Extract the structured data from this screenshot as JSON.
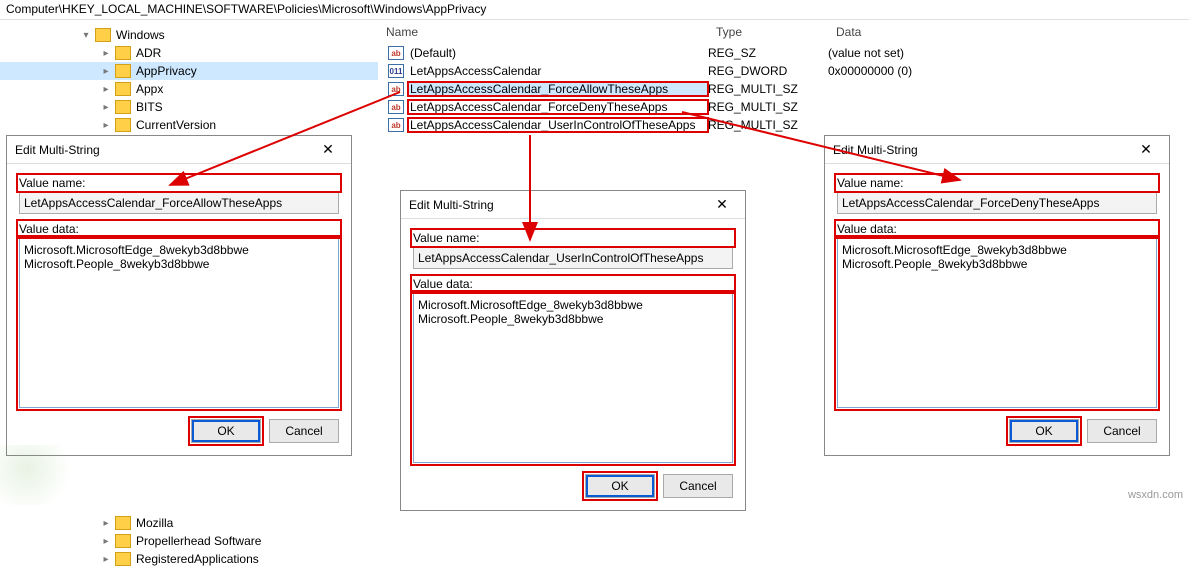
{
  "address": "Computer\\HKEY_LOCAL_MACHINE\\SOFTWARE\\Policies\\Microsoft\\Windows\\AppPrivacy",
  "tree": {
    "open_key": "Windows",
    "items": [
      "ADR",
      "AppPrivacy",
      "Appx",
      "BITS",
      "CurrentVersion"
    ],
    "selected": "AppPrivacy",
    "bottom_items": [
      "Mozilla",
      "Propellerhead Software",
      "RegisteredApplications"
    ]
  },
  "columns": {
    "name": "Name",
    "type": "Type",
    "data": "Data"
  },
  "values": [
    {
      "name": "(Default)",
      "type": "REG_SZ",
      "data": "(value not set)",
      "icon": "str"
    },
    {
      "name": "LetAppsAccessCalendar",
      "type": "REG_DWORD",
      "data": "0x00000000 (0)",
      "icon": "bin"
    },
    {
      "name": "LetAppsAccessCalendar_ForceAllowTheseApps",
      "type": "REG_MULTI_SZ",
      "data": "",
      "icon": "str",
      "selected": true,
      "boxed": true
    },
    {
      "name": "LetAppsAccessCalendar_ForceDenyTheseApps",
      "type": "REG_MULTI_SZ",
      "data": "",
      "icon": "str",
      "boxed": true
    },
    {
      "name": "LetAppsAccessCalendar_UserInControlOfTheseApps",
      "type": "REG_MULTI_SZ",
      "data": "",
      "icon": "str",
      "boxed": true
    }
  ],
  "dialog_title": "Edit Multi-String",
  "labels": {
    "value_name": "Value name:",
    "value_data": "Value data:",
    "ok": "OK",
    "cancel": "Cancel"
  },
  "dialogs": [
    {
      "name": "LetAppsAccessCalendar_ForceAllowTheseApps",
      "data": "Microsoft.MicrosoftEdge_8wekyb3d8bbwe\nMicrosoft.People_8wekyb3d8bbwe"
    },
    {
      "name": "LetAppsAccessCalendar_UserInControlOfTheseApps",
      "data": "Microsoft.MicrosoftEdge_8wekyb3d8bbwe\nMicrosoft.People_8wekyb3d8bbwe"
    },
    {
      "name": "LetAppsAccessCalendar_ForceDenyTheseApps",
      "data": "Microsoft.MicrosoftEdge_8wekyb3d8bbwe\nMicrosoft.People_8wekyb3d8bbwe"
    }
  ],
  "watermark": "wsxdn.com"
}
